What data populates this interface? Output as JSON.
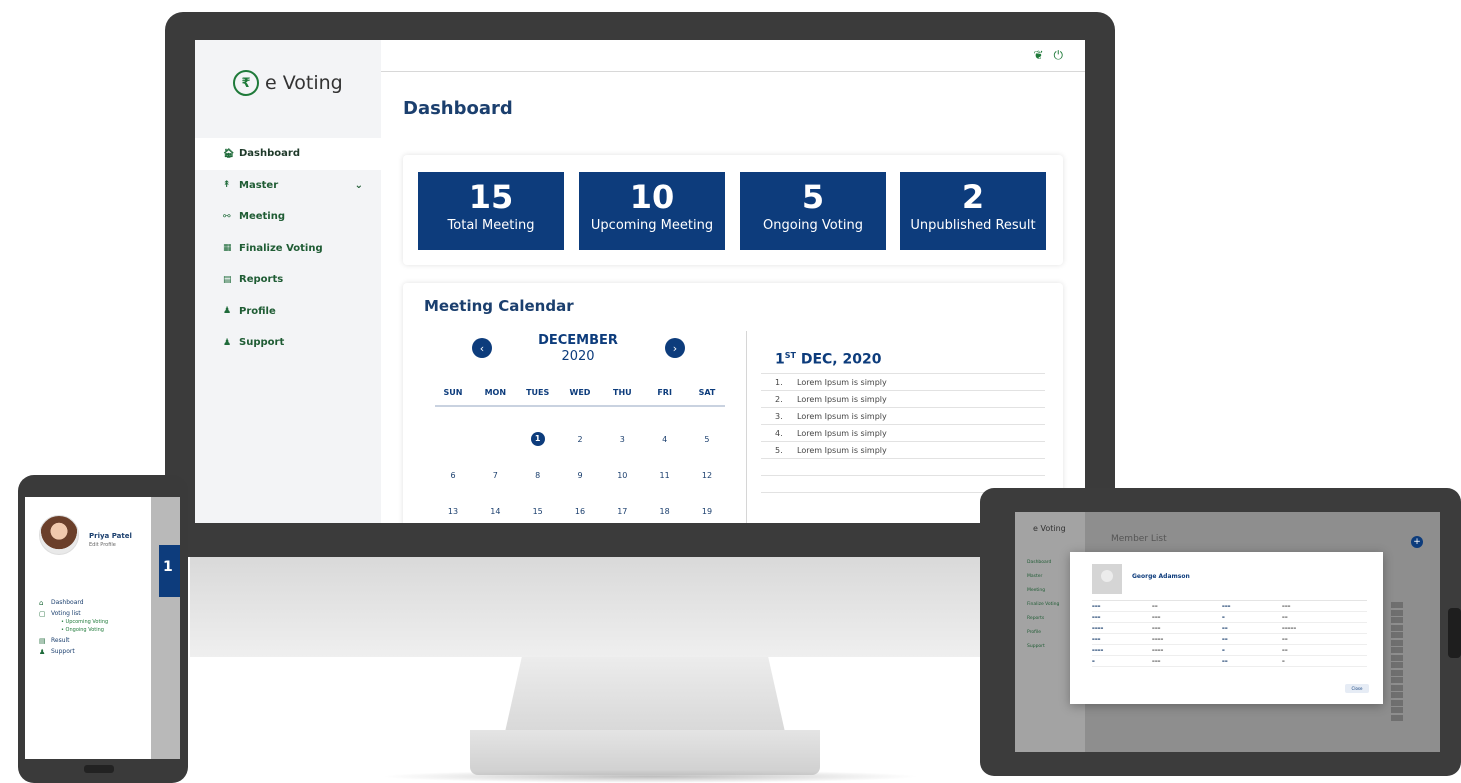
{
  "monitor": {
    "logo": {
      "mark": "₹",
      "text": "e Voting"
    },
    "nav": [
      {
        "label": "Dashboard",
        "icon": "home-icon",
        "glyph": "🏠︎"
      },
      {
        "label": "Master",
        "icon": "master-icon",
        "glyph": "↟"
      },
      {
        "label": "Meeting",
        "icon": "meeting-icon",
        "glyph": "⚯"
      },
      {
        "label": "Finalize Voting",
        "icon": "finalize-icon",
        "glyph": "▦"
      },
      {
        "label": "Reports",
        "icon": "reports-icon",
        "glyph": "▤"
      },
      {
        "label": "Profile",
        "icon": "profile-icon",
        "glyph": "♟"
      },
      {
        "label": "Support",
        "icon": "support-icon",
        "glyph": "♟"
      }
    ],
    "page_title": "Dashboard",
    "stats": [
      {
        "value": "15",
        "label": "Total Meeting"
      },
      {
        "value": "10",
        "label": "Upcoming Meeting"
      },
      {
        "value": "5",
        "label": "Ongoing Voting"
      },
      {
        "value": "2",
        "label": "Unpublished Result"
      }
    ],
    "calendar": {
      "title": "Meeting Calendar",
      "month": "DECEMBER",
      "year": "2020",
      "weekdays": [
        "SUN",
        "MON",
        "TUES",
        "WED",
        "THU",
        "FRI",
        "SAT"
      ],
      "rows": [
        [
          "",
          "",
          "1",
          "2",
          "3",
          "4",
          "5"
        ],
        [
          "6",
          "7",
          "8",
          "9",
          "10",
          "11",
          "12"
        ],
        [
          "13",
          "14",
          "15",
          "16",
          "17",
          "18",
          "19"
        ]
      ],
      "selected_day": "1"
    },
    "events": {
      "date_day": "1",
      "date_suffix": "ST",
      "date_rest": "DEC, 2020",
      "items": [
        {
          "num": "1.",
          "text": "Lorem Ipsum is simply"
        },
        {
          "num": "2.",
          "text": "Lorem Ipsum is simply"
        },
        {
          "num": "3.",
          "text": "Lorem Ipsum is simply"
        },
        {
          "num": "4.",
          "text": "Lorem Ipsum is simply"
        },
        {
          "num": "5.",
          "text": "Lorem Ipsum is simply"
        }
      ]
    }
  },
  "phone": {
    "user_name": "Priya Patel",
    "user_sub": "Edit Profile",
    "tile_value": "1",
    "nav": [
      {
        "label": "Dashboard"
      },
      {
        "label": "Voting list"
      },
      {
        "label": "Result"
      },
      {
        "label": "Support"
      }
    ],
    "sub_items": [
      "• Upcoming Voting",
      "• Ongoing Voting"
    ]
  },
  "tablet": {
    "logo": "e Voting",
    "title": "Member List",
    "plus": "+",
    "nav": [
      "Dashboard",
      "Master",
      "Meeting",
      "Finalize Voting",
      "Reports",
      "Profile",
      "Support"
    ],
    "modal_name": "George Adamson",
    "modal_button": "Close"
  },
  "colors": {
    "primary": "#0d3c7c",
    "accent_green": "#1f7a3a",
    "frame": "#3b3b3b"
  }
}
